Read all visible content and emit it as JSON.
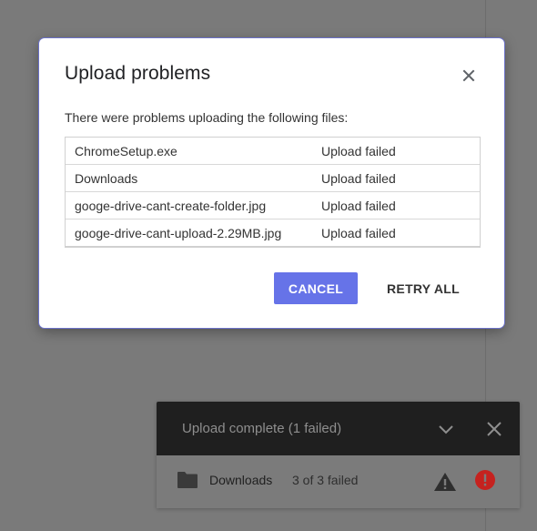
{
  "dialog": {
    "title": "Upload problems",
    "message": "There were problems uploading the following files:",
    "files": [
      {
        "name": "ChromeSetup.exe",
        "status": "Upload failed"
      },
      {
        "name": "Downloads",
        "status": "Upload failed"
      },
      {
        "name": "googe-drive-cant-create-folder.jpg",
        "status": "Upload failed"
      },
      {
        "name": "googe-drive-cant-upload-2.29MB.jpg",
        "status": "Upload failed"
      }
    ],
    "cancel_label": "CANCEL",
    "retry_label": "RETRY ALL",
    "close_icon": "close-icon",
    "accent_color": "#6673e8"
  },
  "upload_panel": {
    "title": "Upload complete (1 failed)",
    "chevron_icon": "chevron-down-icon",
    "close_icon": "close-icon",
    "item": {
      "icon": "folder-icon",
      "name": "Downloads",
      "count": "3 of 3 failed",
      "warning_icon": "warning-icon",
      "error_icon": "error-icon",
      "error_color": "#c5221f"
    }
  }
}
